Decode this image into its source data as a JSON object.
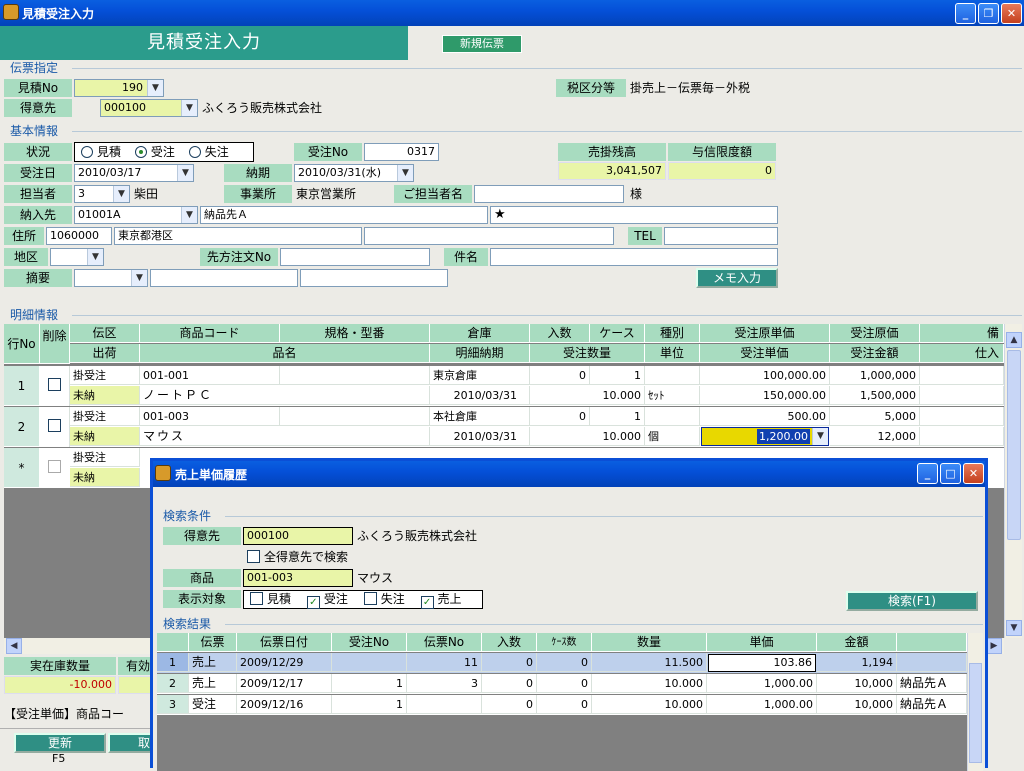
{
  "window": {
    "title": "見積受注入力"
  },
  "banner": {
    "title": "見積受注入力",
    "new_button": "新規伝票"
  },
  "denpyo": {
    "section": "伝票指定",
    "mitsumori_label": "見積No",
    "mitsumori_value": "190",
    "tokuisaki_label": "得意先",
    "tokuisaki_code": "000100",
    "tokuisaki_name": "ふくろう販売株式会社",
    "zei_label": "税区分等",
    "zei_value": "掛売上－伝票毎－外税"
  },
  "kihon": {
    "section": "基本情報",
    "status_label": "状況",
    "status_options": [
      "見積",
      "受注",
      "失注"
    ],
    "juchu_no_label": "受注No",
    "juchu_no_value": "0317",
    "urikake_label": "売掛残高",
    "urikake_value": "3,041,507",
    "yoshin_label": "与信限度額",
    "yoshin_value": "0",
    "juchu_date_label": "受注日",
    "juchu_date_value": "2010/03/17",
    "noki_label": "納期",
    "noki_value": "2010/03/31(水)",
    "tanto_label": "担当者",
    "tanto_code": "3",
    "tanto_name": "柴田",
    "jigyosho_label": "事業所",
    "jigyosho_value": "東京営業所",
    "gotanto_label": "ご担当者名",
    "gotanto_suffix": "様",
    "nonyu_label": "納入先",
    "nonyu_code": "01001A",
    "nonyu_name": "納品先Ａ",
    "nonyu_mark": "★",
    "address_label": "住所",
    "zip": "1060000",
    "address": "東京都港区",
    "tel_label": "TEL",
    "chiku_label": "地区",
    "sakikata_label": "先方注文No",
    "kenmei_label": "件名",
    "tekiyo_label": "摘要",
    "memo_button": "メモ入力"
  },
  "meisai": {
    "section": "明細情報",
    "head_row1": [
      "伝区",
      "商品コード",
      "規格・型番",
      "倉庫",
      "入数",
      "ケース",
      "種別",
      "受注原単価",
      "受注原価",
      "備"
    ],
    "head_row2": [
      "出荷",
      "品名",
      "明細納期",
      "受注数量",
      "単位",
      "受注単価",
      "受注金額",
      "仕入"
    ],
    "row_no_label": "行No",
    "delete_label": "削除",
    "rows": [
      {
        "no": "1",
        "denku": "掛受注",
        "code": "001-001",
        "soko": "東京倉庫",
        "irisu": "0",
        "case": "1",
        "genka_tanka": "100,000.00",
        "genka": "1,000,000",
        "shukka": "未納",
        "name": "ノートＰＣ",
        "noki": "2010/03/31",
        "qty": "10.000",
        "unit": "ｾｯﾄ",
        "tanka": "150,000.00",
        "kingaku": "1,500,000"
      },
      {
        "no": "2",
        "denku": "掛受注",
        "code": "001-003",
        "soko": "本社倉庫",
        "irisu": "0",
        "case": "1",
        "genka_tanka": "500.00",
        "genka": "5,000",
        "shukka": "未納",
        "name": "マウス",
        "noki": "2010/03/31",
        "qty": "10.000",
        "unit": "個",
        "tanka": "1,200.00",
        "kingaku": "12,000"
      },
      {
        "no": "*",
        "denku": "掛受注",
        "shukka": "未納"
      }
    ]
  },
  "bottom": {
    "zaiko_label": "実在庫数量",
    "zaiko_value": "-10.000",
    "yuko_label": "有効",
    "status_text": "【受注単価】商品コー",
    "update_button": "更新",
    "update_key": "F5",
    "second_button": "取"
  },
  "dialog": {
    "title": "売上単価履歴",
    "criteria_section": "検索条件",
    "tokuisaki_label": "得意先",
    "tokuisaki_code": "000100",
    "tokuisaki_name": "ふくろう販売株式会社",
    "all_customers": "全得意先で検索",
    "shohin_label": "商品",
    "shohin_code": "001-003",
    "shohin_name": "マウス",
    "hyoji_label": "表示対象",
    "targets": [
      {
        "label": "見積",
        "checked": false
      },
      {
        "label": "受注",
        "checked": true
      },
      {
        "label": "失注",
        "checked": false
      },
      {
        "label": "売上",
        "checked": true
      }
    ],
    "search_button": "検索(F1)",
    "result_section": "検索結果",
    "columns": [
      "伝票",
      "伝票日付",
      "受注No",
      "伝票No",
      "入数",
      "ｹｰｽ数",
      "数量",
      "単価",
      "金額",
      ""
    ],
    "rows": [
      {
        "no": "1",
        "type": "売上",
        "date": "2009/12/29",
        "juchu": "",
        "denpyo": "11",
        "irisu": "0",
        "case": "0",
        "qty": "11.500",
        "tanka": "103.86",
        "kingaku": "1,194",
        "dest": ""
      },
      {
        "no": "2",
        "type": "売上",
        "date": "2009/12/17",
        "juchu": "1",
        "denpyo": "3",
        "irisu": "0",
        "case": "0",
        "qty": "10.000",
        "tanka": "1,000.00",
        "kingaku": "10,000",
        "dest": "納品先Ａ"
      },
      {
        "no": "3",
        "type": "受注",
        "date": "2009/12/16",
        "juchu": "1",
        "denpyo": "",
        "irisu": "0",
        "case": "0",
        "qty": "10.000",
        "tanka": "1,000.00",
        "kingaku": "10,000",
        "dest": "納品先Ａ"
      }
    ]
  }
}
